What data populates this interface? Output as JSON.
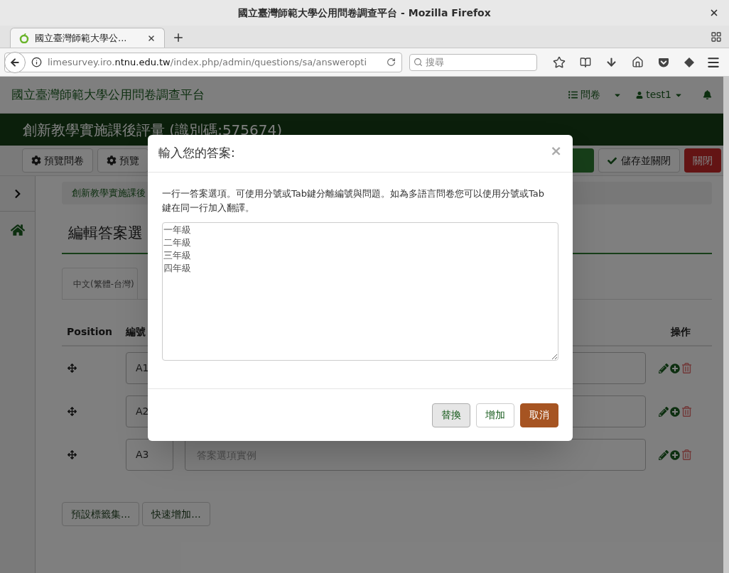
{
  "browser": {
    "window_title": "國立臺灣師範大學公用問卷調查平台 - Mozilla Firefox",
    "tab_title": "國立臺灣師範大學公...",
    "url": {
      "prefix": "limesurvey.iro.",
      "domain": "ntnu.edu.tw",
      "path": "/index.php/admin/questions/sa/answeropti"
    },
    "search_placeholder": "搜尋"
  },
  "navbar": {
    "site_title": "國立臺灣師範大學公用問卷調查平台",
    "menu": "問卷",
    "user": "test1"
  },
  "survey_title": "創新教學實施課後評量 (識別碼:575674)",
  "toolbar": {
    "left_buttons": [
      "預覽問卷",
      "預覽"
    ],
    "right_buttons": [
      {
        "kind": "primary"
      },
      {
        "kind": "save",
        "label": "儲存並關閉"
      },
      {
        "kind": "close",
        "label": "關閉"
      }
    ]
  },
  "breadcrumb": "創新教學實施課後",
  "section_title": "編輯答案選",
  "language_tab": "中文(繁體-台灣)",
  "table": {
    "columns": [
      "Position",
      "編號",
      "操作"
    ],
    "rows": [
      {
        "code": "A1"
      },
      {
        "code": "A2"
      },
      {
        "code": "A3",
        "answer_placeholder": "答案選項實例"
      }
    ]
  },
  "bottom_buttons": [
    "預設標籤集...",
    "快速增加..."
  ],
  "modal": {
    "title": "輸入您的答案:",
    "close": "×",
    "instructions": "一行一答案選項。可使用分號或Tab鍵分離編號與問題。如為多語言問卷您可以使用分號或Tab鍵在同一行加入翻譯。",
    "answers": [
      "一年級",
      "二年級",
      "三年級",
      "四年級"
    ],
    "buttons": [
      {
        "kind": "default",
        "label": "替換",
        "hovered": true
      },
      {
        "kind": "default",
        "label": "增加",
        "hovered": false
      },
      {
        "kind": "cancel",
        "label": "取消",
        "hovered": false
      }
    ]
  }
}
